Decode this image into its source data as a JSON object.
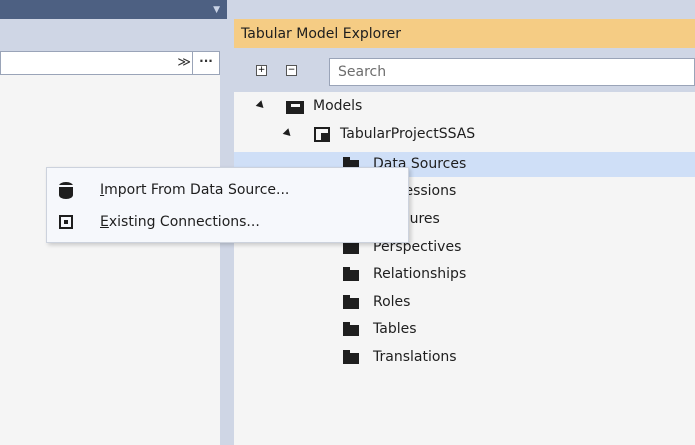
{
  "left_pane": {
    "dropdown_chevron": "≫",
    "more_label": "···"
  },
  "explorer": {
    "title": "Tabular Model Explorer",
    "expand_all_label": "+",
    "collapse_all_label": "−",
    "search": {
      "placeholder": "Search",
      "value": ""
    },
    "tree": {
      "models": "Models",
      "project": "TabularProjectSSAS",
      "items": [
        "Data Sources",
        "Expressions",
        "Measures",
        "Perspectives",
        "Relationships",
        "Roles",
        "Tables",
        "Translations"
      ],
      "selected_item": "Data Sources",
      "visible_fragments": {
        "data_sources": "Data Sources",
        "measures": "sures"
      }
    }
  },
  "context_menu": {
    "items": [
      {
        "prefix": "",
        "mnemonic": "I",
        "rest": "mport From Data Source...",
        "icon": "database-icon"
      },
      {
        "prefix": "",
        "mnemonic": "E",
        "rest": "xisting Connections...",
        "icon": "existing-connections-icon"
      }
    ]
  }
}
